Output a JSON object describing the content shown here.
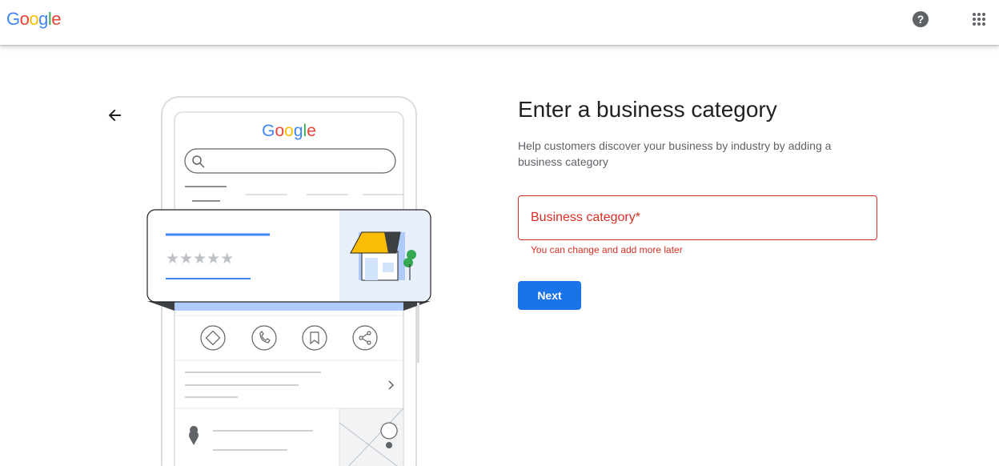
{
  "header": {
    "logo_letters": [
      {
        "char": "G",
        "color": "#4285F4"
      },
      {
        "char": "o",
        "color": "#EA4335"
      },
      {
        "char": "o",
        "color": "#FBBC05"
      },
      {
        "char": "g",
        "color": "#4285F4"
      },
      {
        "char": "l",
        "color": "#34A853"
      },
      {
        "char": "e",
        "color": "#EA4335"
      }
    ],
    "help_icon": "help-circle-icon",
    "apps_icon": "apps-grid-icon"
  },
  "illustration": {
    "logo_text": "Google",
    "stars": "★★★★★"
  },
  "form": {
    "title": "Enter a business category",
    "description": "Help customers discover your business by industry by adding a business category",
    "field_label": "Business category*",
    "field_value": "",
    "helper_text": "You can change and add more later",
    "next_label": "Next",
    "error_color": "#d93025",
    "accent_color": "#1a73e8"
  }
}
